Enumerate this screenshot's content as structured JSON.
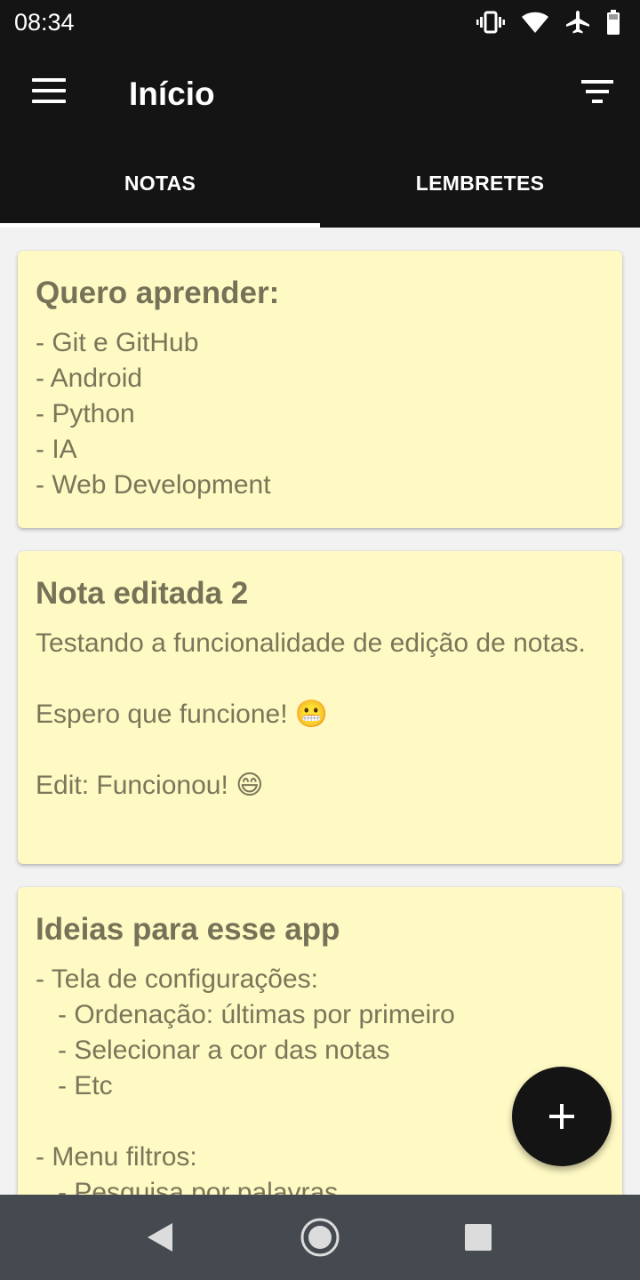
{
  "status_bar": {
    "time": "08:34",
    "icons": [
      "vibrate-icon",
      "wifi-icon",
      "airplane-icon",
      "battery-icon"
    ]
  },
  "app_bar": {
    "title": "Início",
    "menu_icon": "hamburger-menu-icon",
    "filter_icon": "filter-sort-icon"
  },
  "tabs": [
    {
      "label": "NOTAS",
      "active": true
    },
    {
      "label": "LEMBRETES",
      "active": false
    }
  ],
  "notes": [
    {
      "title": "Quero aprender:",
      "body": "- Git e GitHub\n- Android\n- Python\n- IA\n- Web Development"
    },
    {
      "title": "Nota editada 2",
      "body": "Testando a funcionalidade de edição de notas.\n\nEspero que funcione! 😬\n\nEdit: Funcionou! 😄"
    },
    {
      "title": "Ideias para esse app",
      "body": "- Tela de configurações:\n   - Ordenação: últimas por primeiro\n   - Selecionar a cor das notas\n   - Etc\n\n- Menu filtros:\n   - Pesquisa por palavras"
    }
  ],
  "fab": {
    "icon": "plus-icon"
  },
  "nav_bar": {
    "buttons": [
      "back-icon",
      "home-icon",
      "recents-icon"
    ]
  },
  "colors": {
    "bar_background": "#141414",
    "note_background": "#fff9c4",
    "note_text": "#7a7659",
    "nav_bar": "#454a50"
  }
}
